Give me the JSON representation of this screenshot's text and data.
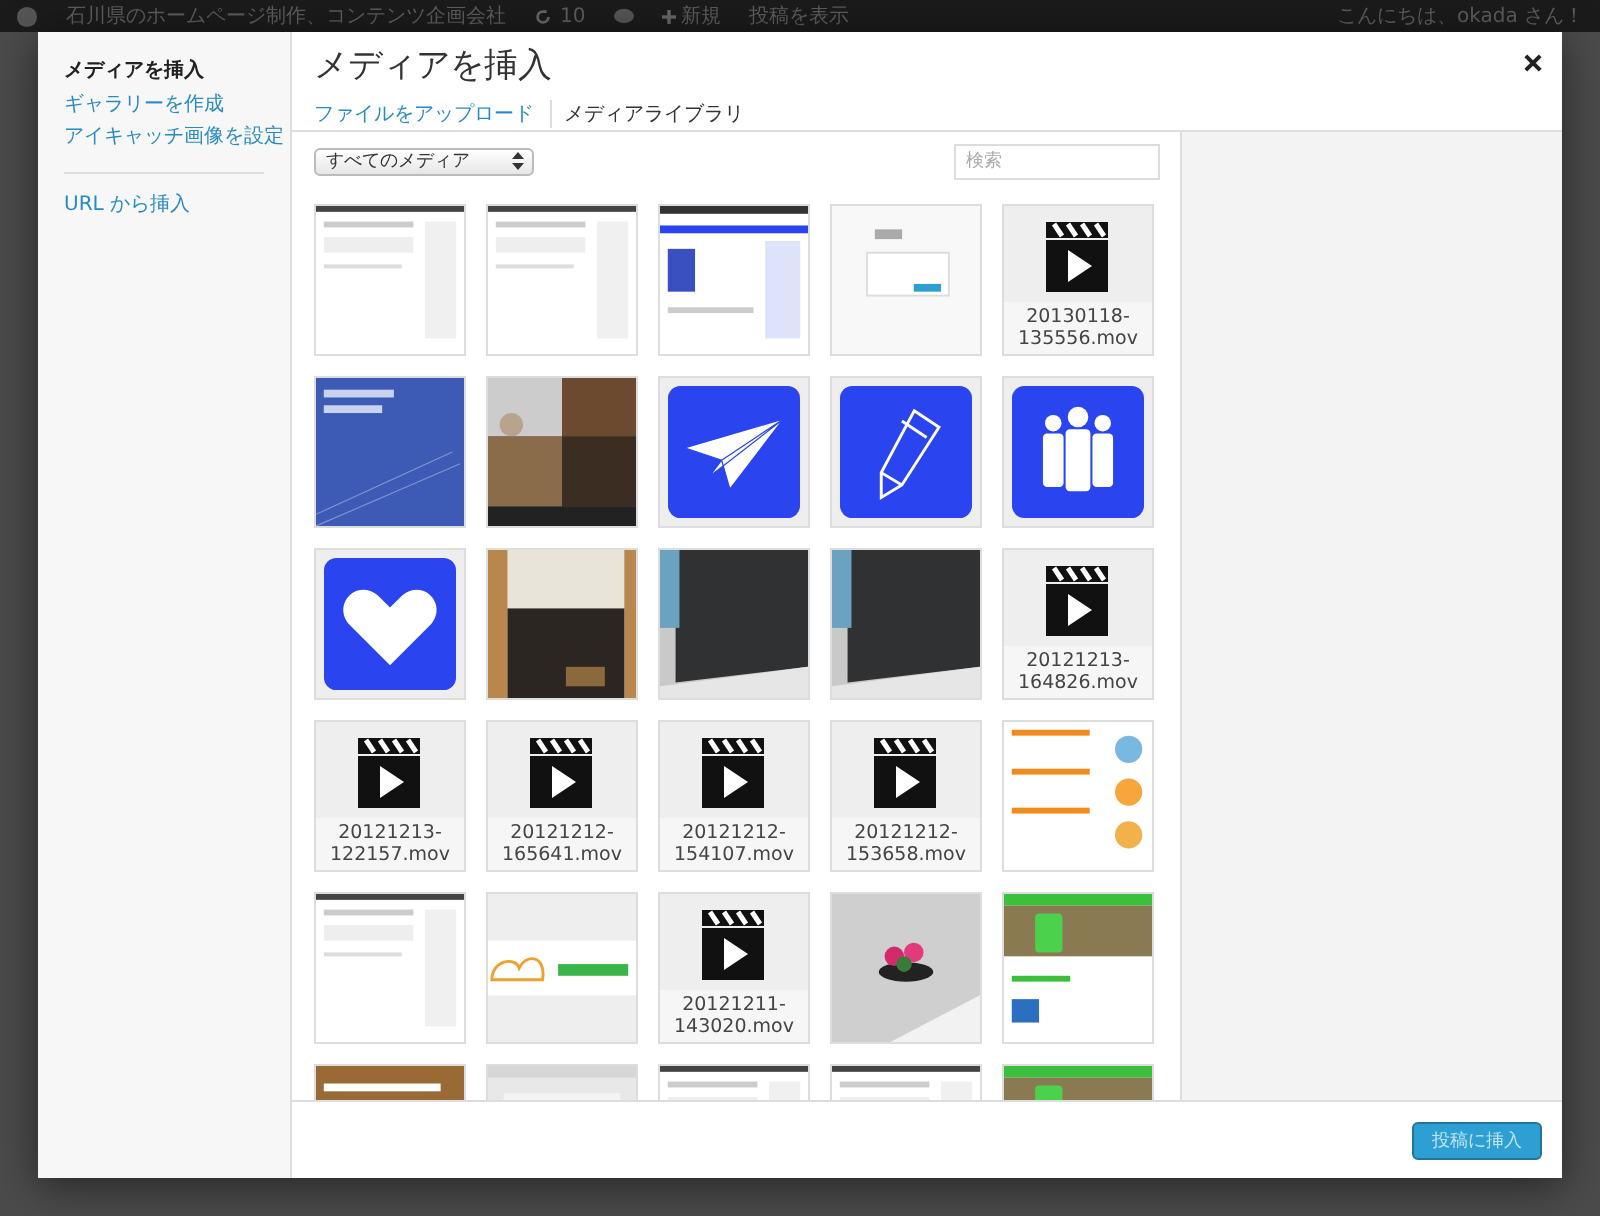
{
  "admin_bar": {
    "site": "石川県のホームページ制作、コンテンツ企画会社",
    "updates": "10",
    "new": "新規",
    "view_post": "投稿を表示",
    "greeting": "こんにちは、okada さん！"
  },
  "sidebar": {
    "items": [
      {
        "label": "メディアを挿入",
        "selected": true
      },
      {
        "label": "ギャラリーを作成",
        "selected": false
      },
      {
        "label": "アイキャッチ画像を設定",
        "selected": false
      },
      {
        "label": "URL から挿入",
        "selected": false
      }
    ]
  },
  "title": "メディアを挿入",
  "tabs": [
    {
      "label": "ファイルをアップロード",
      "selected": false
    },
    {
      "label": "メディアライブラリ",
      "selected": true
    }
  ],
  "filter": {
    "value": "すべてのメディア"
  },
  "search": {
    "placeholder": "検索"
  },
  "items": [
    {
      "kind": "picture"
    },
    {
      "kind": "picture"
    },
    {
      "kind": "picture"
    },
    {
      "kind": "picture"
    },
    {
      "kind": "video",
      "filename": "20130118-135556.mov"
    },
    {
      "kind": "picture"
    },
    {
      "kind": "picture"
    },
    {
      "kind": "plane"
    },
    {
      "kind": "pencil"
    },
    {
      "kind": "people"
    },
    {
      "kind": "heart"
    },
    {
      "kind": "picture"
    },
    {
      "kind": "picture"
    },
    {
      "kind": "picture"
    },
    {
      "kind": "video",
      "filename": "20121213-164826.mov"
    },
    {
      "kind": "video",
      "filename": "20121213-122157.mov"
    },
    {
      "kind": "video",
      "filename": "20121212-165641.mov"
    },
    {
      "kind": "video",
      "filename": "20121212-154107.mov"
    },
    {
      "kind": "video",
      "filename": "20121212-153658.mov"
    },
    {
      "kind": "picture"
    },
    {
      "kind": "picture"
    },
    {
      "kind": "picture"
    },
    {
      "kind": "video",
      "filename": "20121211-143020.mov"
    },
    {
      "kind": "picture"
    },
    {
      "kind": "picture"
    },
    {
      "kind": "picture"
    },
    {
      "kind": "picture"
    },
    {
      "kind": "picture"
    },
    {
      "kind": "picture"
    },
    {
      "kind": "picture"
    }
  ],
  "insert_button": "投稿に挿入"
}
